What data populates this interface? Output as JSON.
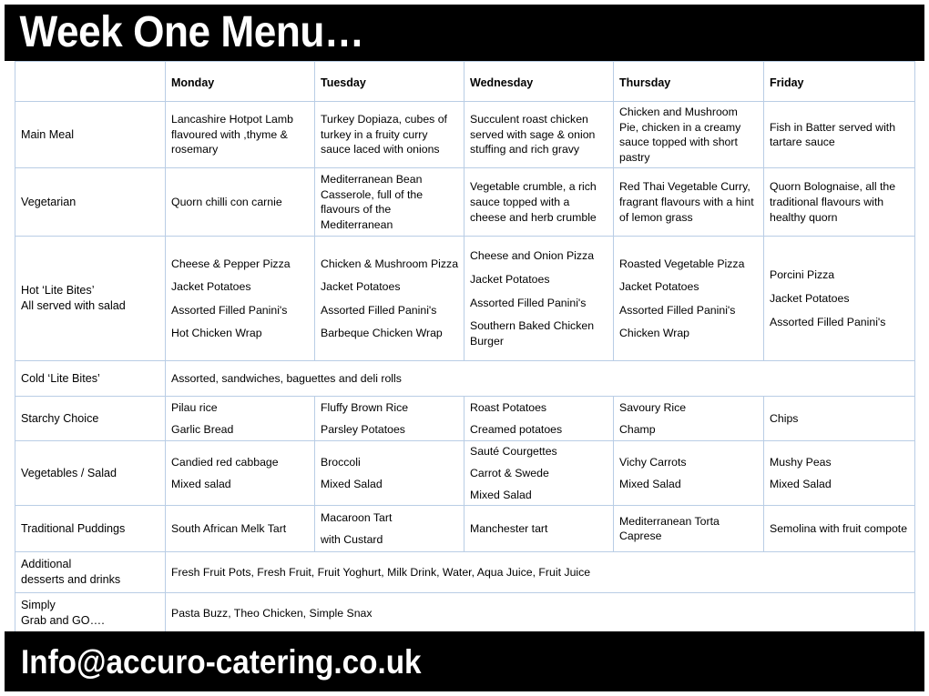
{
  "header": {
    "title": "Week One Menu…",
    "background_color": "#000000",
    "text_color": "#FFFFFF"
  },
  "footer": {
    "contact": "Info@accuro-catering.co.uk",
    "background_color": "#000000",
    "text_color": "#FFFFFF"
  },
  "table": {
    "border_color": "#B9CDE5",
    "corner_label": "",
    "days": [
      "Monday",
      "Tuesday",
      "Wednesday",
      "Thursday",
      "Friday"
    ],
    "rows": [
      {
        "label": "Main Meal",
        "label_lines": [
          "Main Meal"
        ],
        "type": "per-day",
        "cells": [
          [
            "Lancashire Hotpot Lamb flavoured with ,thyme & rosemary"
          ],
          [
            "Turkey Dopiaza, cubes of turkey in a  fruity curry sauce laced with onions"
          ],
          [
            "Succulent roast chicken served with sage & onion stuffing and rich gravy"
          ],
          [
            "Chicken and Mushroom Pie, chicken in a creamy sauce topped with short pastry"
          ],
          [
            "Fish in Batter served with tartare sauce"
          ]
        ]
      },
      {
        "label": "Vegetarian",
        "label_lines": [
          "Vegetarian"
        ],
        "type": "per-day",
        "cells": [
          [
            "Quorn chilli con carnie"
          ],
          [
            "Mediterranean Bean Casserole, full of the flavours of the Mediterranean"
          ],
          [
            "Vegetable crumble, a rich sauce topped with a cheese and herb crumble"
          ],
          [
            "Red Thai Vegetable Curry, fragrant flavours with a hint of lemon grass"
          ],
          [
            "Quorn Bolognaise, all the traditional flavours with healthy quorn"
          ]
        ]
      },
      {
        "label": "Hot ‘Lite Bites’ All served with salad",
        "label_lines": [
          "Hot ‘Lite Bites’",
          "All served with salad"
        ],
        "type": "per-day-list",
        "cells": [
          [
            "Cheese & Pepper Pizza",
            "Jacket Potatoes",
            "Assorted Filled Panini's",
            "Hot Chicken Wrap"
          ],
          [
            "Chicken & Mushroom Pizza",
            "Jacket Potatoes",
            "Assorted Filled Panini's",
            "Barbeque Chicken Wrap"
          ],
          [
            "Cheese and Onion Pizza",
            "Jacket Potatoes",
            "Assorted Filled Panini's",
            "Southern Baked Chicken Burger"
          ],
          [
            "Roasted Vegetable Pizza",
            "Jacket Potatoes",
            "Assorted Filled Panini's",
            "Chicken Wrap"
          ],
          [
            "Porcini Pizza",
            "Jacket Potatoes",
            "Assorted Filled Panini's"
          ]
        ]
      },
      {
        "label": "Cold ‘Lite Bites’",
        "label_lines": [
          "Cold ‘Lite Bites’"
        ],
        "type": "span",
        "span_text": "Assorted, sandwiches, baguettes and deli rolls"
      },
      {
        "label": "Starchy Choice",
        "label_lines": [
          "Starchy Choice"
        ],
        "type": "per-day-list",
        "cells": [
          [
            "Pilau rice",
            "Garlic Bread"
          ],
          [
            "Fluffy Brown Rice",
            "Parsley Potatoes"
          ],
          [
            "Roast Potatoes",
            "Creamed potatoes"
          ],
          [
            "Savoury Rice",
            "Champ"
          ],
          [
            "Chips"
          ]
        ]
      },
      {
        "label": "Vegetables / Salad",
        "label_lines": [
          "Vegetables / Salad"
        ],
        "type": "per-day-list",
        "cells": [
          [
            "Candied red cabbage",
            "Mixed salad"
          ],
          [
            "Broccoli",
            "Mixed Salad"
          ],
          [
            "Sauté Courgettes",
            " Carrot & Swede",
            "Mixed Salad"
          ],
          [
            "Vichy Carrots",
            "Mixed Salad"
          ],
          [
            "Mushy Peas",
            "Mixed Salad"
          ]
        ]
      },
      {
        "label": "Traditional Puddings",
        "label_lines": [
          "Traditional Puddings"
        ],
        "type": "per-day-list",
        "cells": [
          [
            "South African Melk Tart"
          ],
          [
            "Macaroon Tart",
            " with Custard"
          ],
          [
            "Manchester tart"
          ],
          [
            "Mediterranean Torta Caprese"
          ],
          [
            "Semolina with  fruit compote"
          ]
        ]
      },
      {
        "label": "Additional desserts and drinks",
        "label_lines": [
          "Additional",
          "desserts and drinks"
        ],
        "type": "span",
        "span_text": "Fresh Fruit Pots,  Fresh Fruit,  Fruit Yoghurt,  Milk Drink,  Water,  Aqua Juice,  Fruit Juice"
      },
      {
        "label": "Simply Grab and GO….",
        "label_lines": [
          "Simply",
          "Grab and GO…."
        ],
        "type": "span",
        "span_text": "Pasta Buzz,  Theo Chicken, Simple Snax"
      }
    ]
  }
}
